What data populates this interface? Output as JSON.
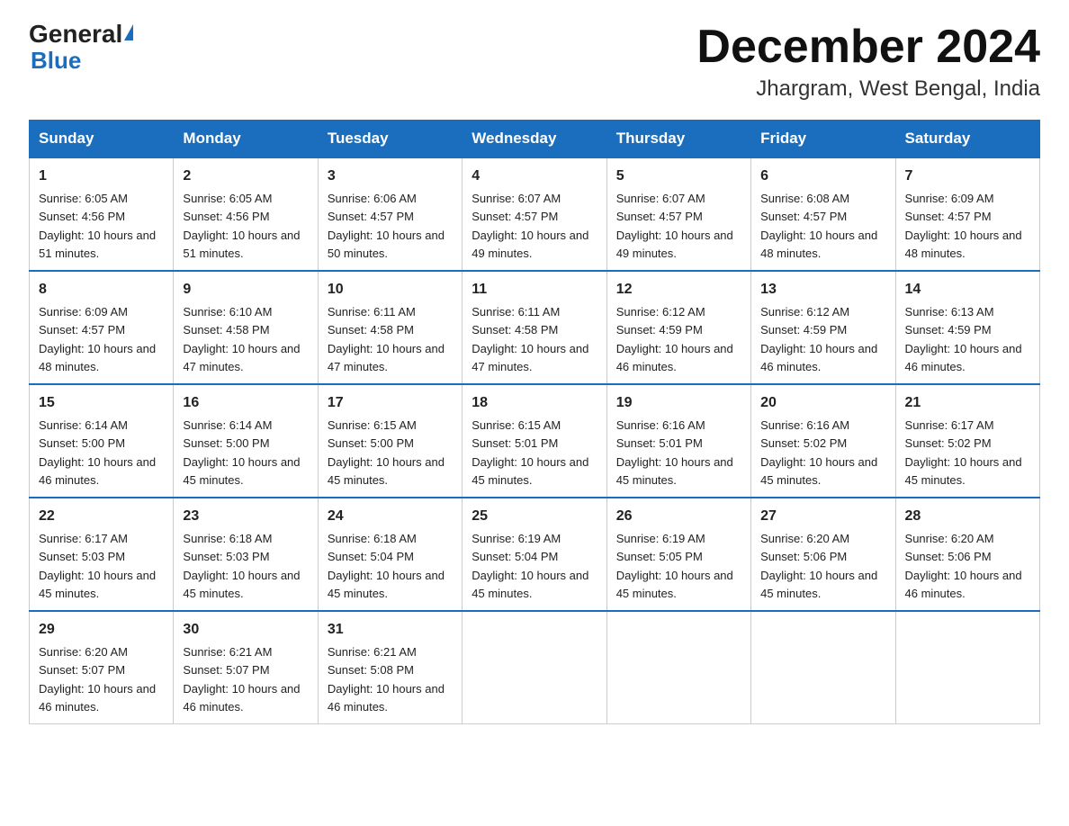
{
  "logo": {
    "general": "General",
    "triangle": "▲",
    "blue": "Blue"
  },
  "title": {
    "month": "December 2024",
    "location": "Jhargram, West Bengal, India"
  },
  "headers": [
    "Sunday",
    "Monday",
    "Tuesday",
    "Wednesday",
    "Thursday",
    "Friday",
    "Saturday"
  ],
  "weeks": [
    [
      {
        "day": "1",
        "sunrise": "6:05 AM",
        "sunset": "4:56 PM",
        "daylight": "10 hours and 51 minutes."
      },
      {
        "day": "2",
        "sunrise": "6:05 AM",
        "sunset": "4:56 PM",
        "daylight": "10 hours and 51 minutes."
      },
      {
        "day": "3",
        "sunrise": "6:06 AM",
        "sunset": "4:57 PM",
        "daylight": "10 hours and 50 minutes."
      },
      {
        "day": "4",
        "sunrise": "6:07 AM",
        "sunset": "4:57 PM",
        "daylight": "10 hours and 49 minutes."
      },
      {
        "day": "5",
        "sunrise": "6:07 AM",
        "sunset": "4:57 PM",
        "daylight": "10 hours and 49 minutes."
      },
      {
        "day": "6",
        "sunrise": "6:08 AM",
        "sunset": "4:57 PM",
        "daylight": "10 hours and 48 minutes."
      },
      {
        "day": "7",
        "sunrise": "6:09 AM",
        "sunset": "4:57 PM",
        "daylight": "10 hours and 48 minutes."
      }
    ],
    [
      {
        "day": "8",
        "sunrise": "6:09 AM",
        "sunset": "4:57 PM",
        "daylight": "10 hours and 48 minutes."
      },
      {
        "day": "9",
        "sunrise": "6:10 AM",
        "sunset": "4:58 PM",
        "daylight": "10 hours and 47 minutes."
      },
      {
        "day": "10",
        "sunrise": "6:11 AM",
        "sunset": "4:58 PM",
        "daylight": "10 hours and 47 minutes."
      },
      {
        "day": "11",
        "sunrise": "6:11 AM",
        "sunset": "4:58 PM",
        "daylight": "10 hours and 47 minutes."
      },
      {
        "day": "12",
        "sunrise": "6:12 AM",
        "sunset": "4:59 PM",
        "daylight": "10 hours and 46 minutes."
      },
      {
        "day": "13",
        "sunrise": "6:12 AM",
        "sunset": "4:59 PM",
        "daylight": "10 hours and 46 minutes."
      },
      {
        "day": "14",
        "sunrise": "6:13 AM",
        "sunset": "4:59 PM",
        "daylight": "10 hours and 46 minutes."
      }
    ],
    [
      {
        "day": "15",
        "sunrise": "6:14 AM",
        "sunset": "5:00 PM",
        "daylight": "10 hours and 46 minutes."
      },
      {
        "day": "16",
        "sunrise": "6:14 AM",
        "sunset": "5:00 PM",
        "daylight": "10 hours and 45 minutes."
      },
      {
        "day": "17",
        "sunrise": "6:15 AM",
        "sunset": "5:00 PM",
        "daylight": "10 hours and 45 minutes."
      },
      {
        "day": "18",
        "sunrise": "6:15 AM",
        "sunset": "5:01 PM",
        "daylight": "10 hours and 45 minutes."
      },
      {
        "day": "19",
        "sunrise": "6:16 AM",
        "sunset": "5:01 PM",
        "daylight": "10 hours and 45 minutes."
      },
      {
        "day": "20",
        "sunrise": "6:16 AM",
        "sunset": "5:02 PM",
        "daylight": "10 hours and 45 minutes."
      },
      {
        "day": "21",
        "sunrise": "6:17 AM",
        "sunset": "5:02 PM",
        "daylight": "10 hours and 45 minutes."
      }
    ],
    [
      {
        "day": "22",
        "sunrise": "6:17 AM",
        "sunset": "5:03 PM",
        "daylight": "10 hours and 45 minutes."
      },
      {
        "day": "23",
        "sunrise": "6:18 AM",
        "sunset": "5:03 PM",
        "daylight": "10 hours and 45 minutes."
      },
      {
        "day": "24",
        "sunrise": "6:18 AM",
        "sunset": "5:04 PM",
        "daylight": "10 hours and 45 minutes."
      },
      {
        "day": "25",
        "sunrise": "6:19 AM",
        "sunset": "5:04 PM",
        "daylight": "10 hours and 45 minutes."
      },
      {
        "day": "26",
        "sunrise": "6:19 AM",
        "sunset": "5:05 PM",
        "daylight": "10 hours and 45 minutes."
      },
      {
        "day": "27",
        "sunrise": "6:20 AM",
        "sunset": "5:06 PM",
        "daylight": "10 hours and 45 minutes."
      },
      {
        "day": "28",
        "sunrise": "6:20 AM",
        "sunset": "5:06 PM",
        "daylight": "10 hours and 46 minutes."
      }
    ],
    [
      {
        "day": "29",
        "sunrise": "6:20 AM",
        "sunset": "5:07 PM",
        "daylight": "10 hours and 46 minutes."
      },
      {
        "day": "30",
        "sunrise": "6:21 AM",
        "sunset": "5:07 PM",
        "daylight": "10 hours and 46 minutes."
      },
      {
        "day": "31",
        "sunrise": "6:21 AM",
        "sunset": "5:08 PM",
        "daylight": "10 hours and 46 minutes."
      },
      null,
      null,
      null,
      null
    ]
  ]
}
